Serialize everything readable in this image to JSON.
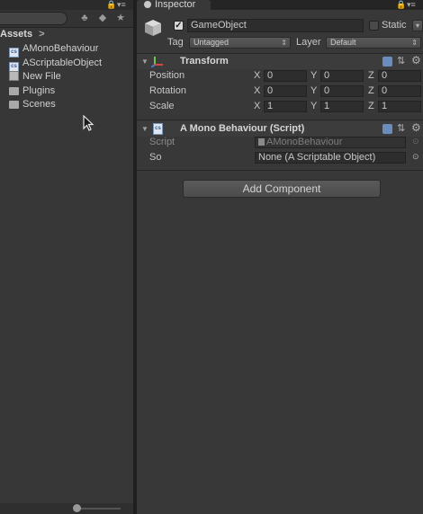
{
  "project": {
    "breadcrumb": "Assets",
    "items": [
      {
        "label": "AMonoBehaviour",
        "icon": "script-icon"
      },
      {
        "label": "AScriptableObject",
        "icon": "script-icon"
      },
      {
        "label": "New File",
        "icon": "file-icon"
      },
      {
        "label": "Plugins",
        "icon": "folder-icon"
      },
      {
        "label": "Scenes",
        "icon": "folder-icon"
      }
    ]
  },
  "inspector": {
    "tab_label": "Inspector",
    "object": {
      "active": true,
      "name": "GameObject",
      "static_label": "Static",
      "static": false,
      "tag_label": "Tag",
      "tag_value": "Untagged",
      "layer_label": "Layer",
      "layer_value": "Default"
    },
    "transform": {
      "title": "Transform",
      "rows": [
        {
          "label": "Position",
          "x": "0",
          "y": "0",
          "z": "0"
        },
        {
          "label": "Rotation",
          "x": "0",
          "y": "0",
          "z": "0"
        },
        {
          "label": "Scale",
          "x": "1",
          "y": "1",
          "z": "1"
        }
      ],
      "axis_x": "X",
      "axis_y": "Y",
      "axis_z": "Z"
    },
    "script_component": {
      "title": "A Mono Behaviour (Script)",
      "script_label": "Script",
      "script_value": "AMonoBehaviour",
      "so_label": "So",
      "so_value": "None (A Scriptable Object)"
    },
    "add_component_label": "Add Component"
  },
  "colors": {
    "background": "#383838",
    "panel_dark": "#2b2b2b",
    "field": "#2d2d2d",
    "text": "#c8c8c8"
  }
}
